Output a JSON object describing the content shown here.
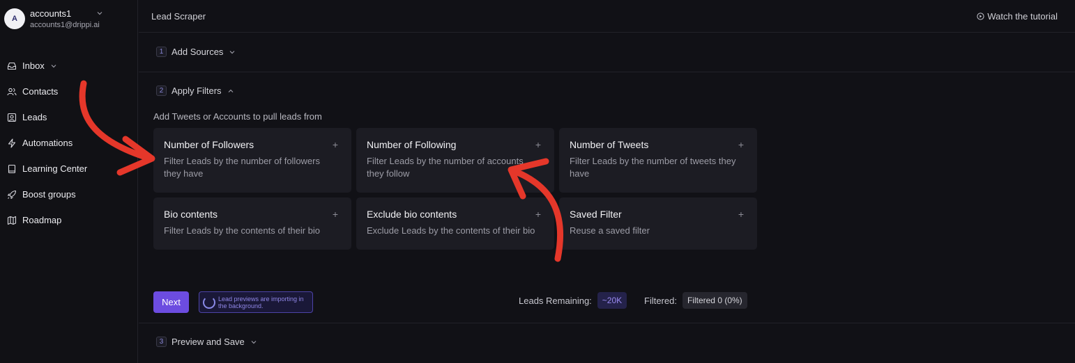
{
  "account": {
    "initial": "A",
    "name": "accounts1",
    "email": "accounts1@drippi.ai"
  },
  "nav": [
    {
      "label": "Inbox",
      "icon": "inbox-icon"
    },
    {
      "label": "Contacts",
      "icon": "users-icon"
    },
    {
      "label": "Leads",
      "icon": "leads-icon"
    },
    {
      "label": "Automations",
      "icon": "lightning-icon"
    },
    {
      "label": "Learning Center",
      "icon": "book-icon"
    },
    {
      "label": "Boost groups",
      "icon": "rocket-icon"
    },
    {
      "label": "Roadmap",
      "icon": "map-icon"
    }
  ],
  "header": {
    "title": "Lead Scraper",
    "tutorial": "Watch the tutorial"
  },
  "steps": [
    {
      "num": "1",
      "label": "Add Sources"
    },
    {
      "num": "2",
      "label": "Apply Filters"
    },
    {
      "num": "3",
      "label": "Preview and Save"
    }
  ],
  "filters_subtitle": "Add Tweets or Accounts to pull leads from",
  "filters": [
    {
      "title": "Number of Followers",
      "desc": "Filter Leads by the number of followers they have"
    },
    {
      "title": "Number of Following",
      "desc": "Filter Leads by the number of accounts they follow"
    },
    {
      "title": "Number of Tweets",
      "desc": "Filter Leads by the number of tweets they have"
    },
    {
      "title": "Bio contents",
      "desc": "Filter Leads by the contents of their bio"
    },
    {
      "title": "Exclude bio contents",
      "desc": "Exclude Leads by the contents of their bio"
    },
    {
      "title": "Saved Filter",
      "desc": "Reuse a saved filter"
    }
  ],
  "plus_symbol": "+",
  "footer": {
    "next_label": "Next",
    "import_status": "Lead previews are importing in the background.",
    "leads_remaining_label": "Leads Remaining:",
    "leads_remaining_value": "~20K",
    "filtered_label": "Filtered:",
    "filtered_value": "Filtered 0 (0%)"
  },
  "colors": {
    "accent": "#6c4ce0",
    "annotation_arrow": "#e5372a",
    "background": "#111116",
    "card": "#1c1c23"
  }
}
